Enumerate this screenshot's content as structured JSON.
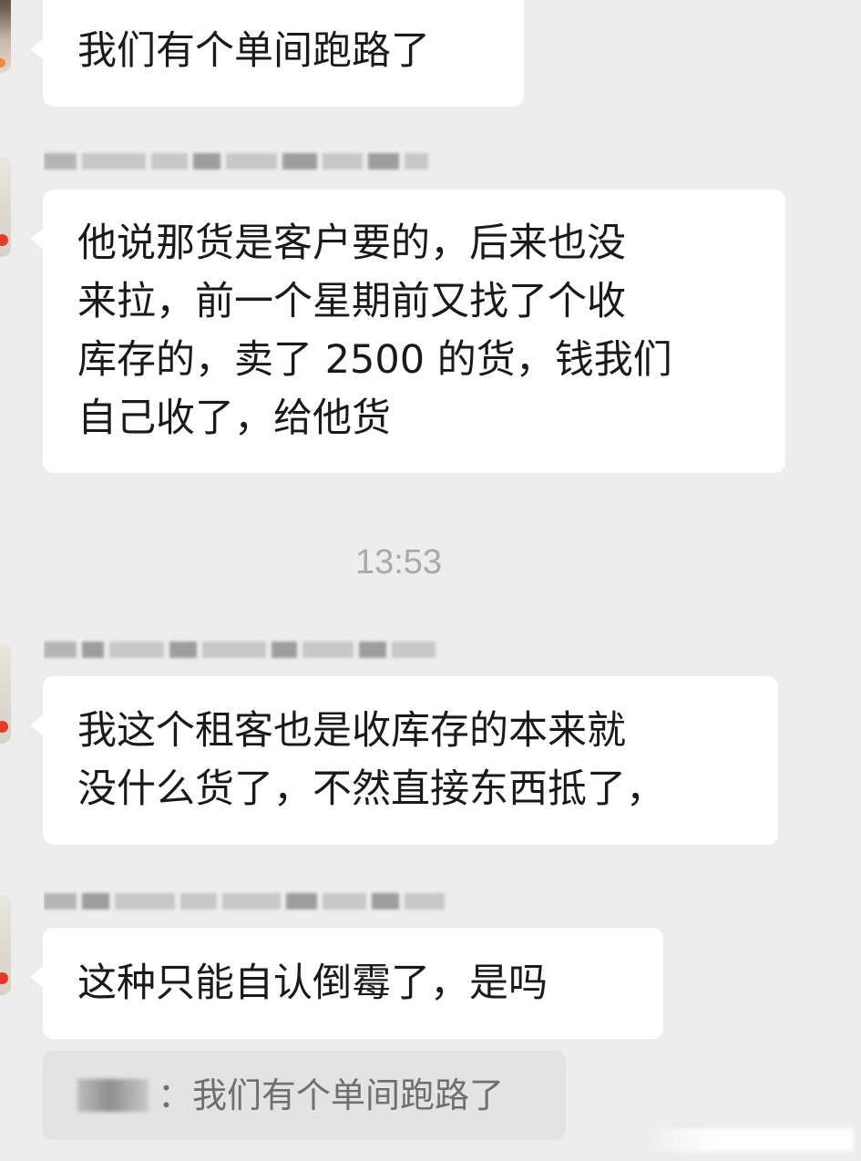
{
  "messages": [
    {
      "sender": "",
      "lines": [
        "我们有个单间跑路了"
      ]
    },
    {
      "sender": "",
      "lines": [
        "他说那货是客户要的，后来也没",
        "来拉，前一个星期前又找了个收",
        "库存的，卖了 2500 的货，钱我们",
        "自己收了，给他货"
      ]
    },
    {
      "sender": "",
      "lines": [
        "我这个租客也是收库存的本来就",
        "没什么货了，不然直接东西抵了，"
      ]
    },
    {
      "sender": "",
      "lines": [
        "这种只能自认倒霉了，是吗"
      ]
    }
  ],
  "timestamp": "13:53",
  "quote": {
    "sender_suffix": "：",
    "text": "我们有个单间跑路了"
  },
  "icons": [
    "avatar-icon"
  ]
}
